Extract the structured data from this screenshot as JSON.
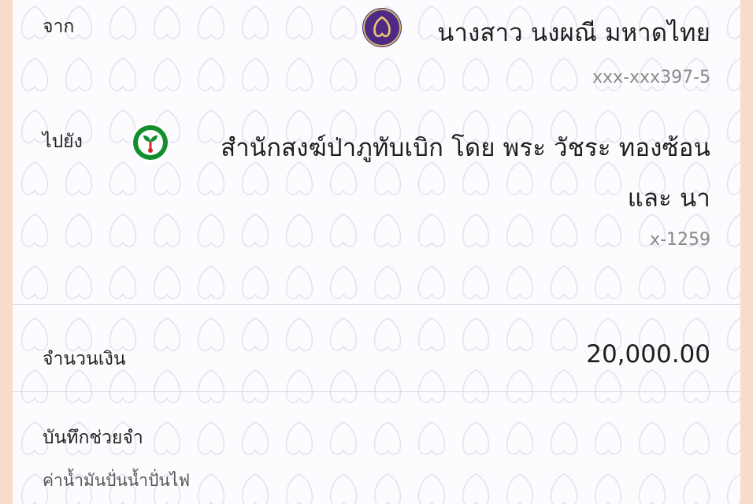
{
  "from": {
    "label": "จาก",
    "name": "นางสาว นงผณี มหาดไทย",
    "account": "xxx-xxx397-5",
    "bank_icon": "scb-bank-icon",
    "bank_color": "#4e2a84"
  },
  "to": {
    "label": "ไปยัง",
    "name_line1": "สำนักสงฆ์ป่าภูทับเบิก โดย พระ วัชระ ทองซ้อน",
    "name_line2": "และ นา",
    "account": "x-1259",
    "bank_icon": "kbank-icon",
    "bank_color": "#138f2d"
  },
  "amount": {
    "label": "จำนวนเงิน",
    "value": "20,000.00"
  },
  "memo": {
    "label": "บันทึกช่วยจำ",
    "text": "ค่าน้ำมันปั่นน้ำปั่นไฟ"
  }
}
